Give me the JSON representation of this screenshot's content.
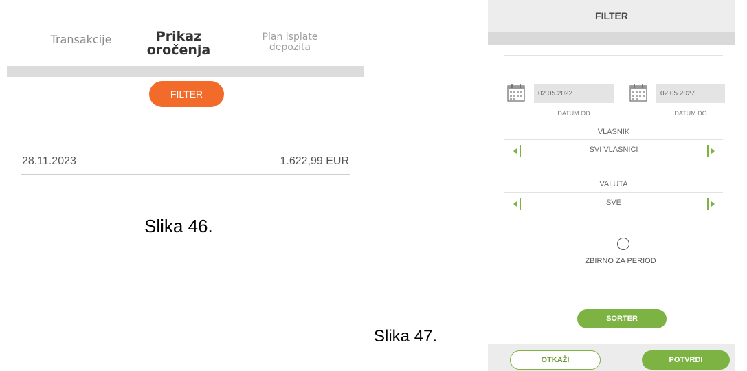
{
  "left_panel": {
    "tabs": [
      {
        "line1": "Transakcije",
        "line2": ""
      },
      {
        "line1": "Prikaz",
        "line2": "oročenja"
      },
      {
        "line1": "Plan isplate",
        "line2": "depozita"
      }
    ],
    "filter_label": "FILTER",
    "rows": [
      {
        "date": "28.11.2023",
        "amount": "1.622,99 EUR"
      }
    ],
    "caption": "Slika 46."
  },
  "right_panel": {
    "title": "FILTER",
    "date_from": {
      "value": "02.05.2022",
      "label": "DATUM OD"
    },
    "date_to": {
      "value": "02.05.2027",
      "label": "DATUM DO"
    },
    "owner": {
      "label": "VLASNIK",
      "value": "SVI VLASNICI"
    },
    "currency": {
      "label": "VALUTA",
      "value": "SVE"
    },
    "summary_label": "ZBIRNO ZA PERIOD",
    "sorter_label": "SORTER",
    "cancel_label": "OTKAŽI",
    "confirm_label": "POTVRDI",
    "caption": "Slika 47."
  },
  "colors": {
    "accent_orange": "#f26b2b",
    "accent_green": "#7cb342"
  },
  "icons": [
    "calendar-icon",
    "chevron-left-icon",
    "chevron-right-icon",
    "radio-icon"
  ]
}
